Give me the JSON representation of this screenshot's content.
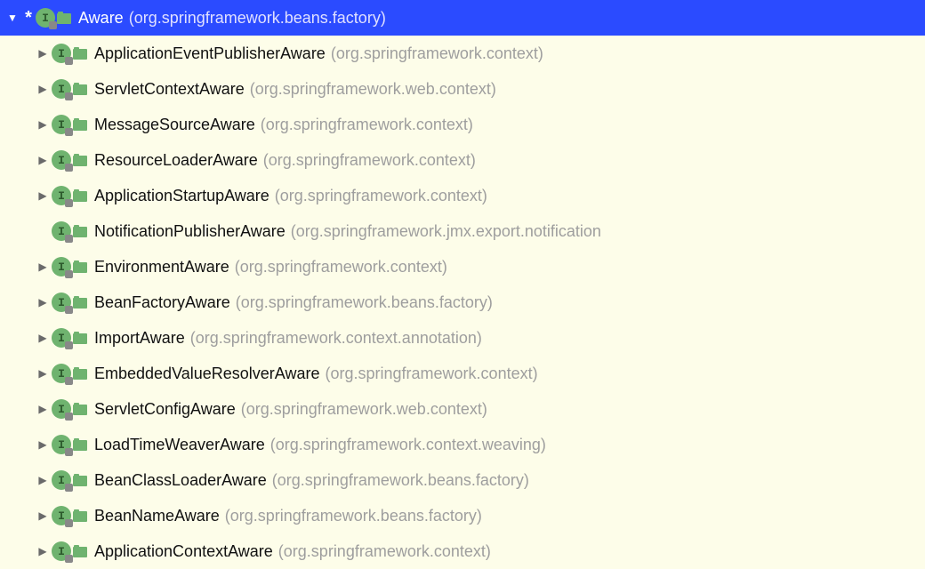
{
  "root": {
    "expanded": true,
    "hasStar": true,
    "iconLetter": "I",
    "name": "Aware",
    "pkg": "(org.springframework.beans.factory)"
  },
  "children": [
    {
      "hasArrow": true,
      "iconLetter": "I",
      "name": "ApplicationEventPublisherAware",
      "pkg": "(org.springframework.context)"
    },
    {
      "hasArrow": true,
      "iconLetter": "I",
      "name": "ServletContextAware",
      "pkg": "(org.springframework.web.context)"
    },
    {
      "hasArrow": true,
      "iconLetter": "I",
      "name": "MessageSourceAware",
      "pkg": "(org.springframework.context)"
    },
    {
      "hasArrow": true,
      "iconLetter": "I",
      "name": "ResourceLoaderAware",
      "pkg": "(org.springframework.context)"
    },
    {
      "hasArrow": true,
      "iconLetter": "I",
      "name": "ApplicationStartupAware",
      "pkg": "(org.springframework.context)"
    },
    {
      "hasArrow": false,
      "iconLetter": "I",
      "name": "NotificationPublisherAware",
      "pkg": "(org.springframework.jmx.export.notification"
    },
    {
      "hasArrow": true,
      "iconLetter": "I",
      "name": "EnvironmentAware",
      "pkg": "(org.springframework.context)"
    },
    {
      "hasArrow": true,
      "iconLetter": "I",
      "name": "BeanFactoryAware",
      "pkg": "(org.springframework.beans.factory)"
    },
    {
      "hasArrow": true,
      "iconLetter": "I",
      "name": "ImportAware",
      "pkg": "(org.springframework.context.annotation)"
    },
    {
      "hasArrow": true,
      "iconLetter": "I",
      "name": "EmbeddedValueResolverAware",
      "pkg": "(org.springframework.context)"
    },
    {
      "hasArrow": true,
      "iconLetter": "I",
      "name": "ServletConfigAware",
      "pkg": "(org.springframework.web.context)"
    },
    {
      "hasArrow": true,
      "iconLetter": "I",
      "name": "LoadTimeWeaverAware",
      "pkg": "(org.springframework.context.weaving)"
    },
    {
      "hasArrow": true,
      "iconLetter": "I",
      "name": "BeanClassLoaderAware",
      "pkg": "(org.springframework.beans.factory)"
    },
    {
      "hasArrow": true,
      "iconLetter": "I",
      "name": "BeanNameAware",
      "pkg": "(org.springframework.beans.factory)"
    },
    {
      "hasArrow": true,
      "iconLetter": "I",
      "name": "ApplicationContextAware",
      "pkg": "(org.springframework.context)"
    }
  ],
  "glyphs": {
    "expandedArrow": "▼",
    "collapsedArrow": "▶",
    "star": "*"
  }
}
